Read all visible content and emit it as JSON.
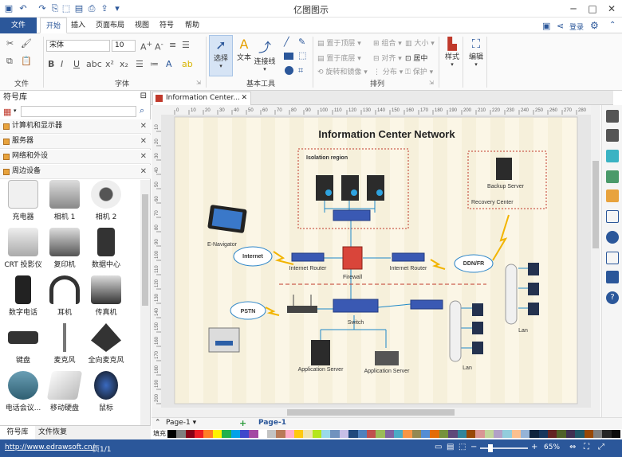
{
  "app": {
    "title": "亿图图示"
  },
  "menu": {
    "file": "文件",
    "tabs": [
      "开始",
      "插入",
      "页面布局",
      "视图",
      "符号",
      "帮助"
    ],
    "login": "登录"
  },
  "ribbon": {
    "font_name": "宋体",
    "font_size": "10",
    "groups": {
      "file": "文件",
      "font": "字体",
      "basic_tools": "基本工具",
      "arrange": "排列"
    },
    "tools": {
      "select": "选择",
      "text": "文本",
      "connector": "连接线",
      "style": "样式",
      "edit": "编辑"
    },
    "arrange": {
      "bring_front": "置于顶层",
      "group": "组合",
      "size": "大小",
      "send_back": "置于底层",
      "align": "对齐",
      "center": "居中",
      "rotate": "旋转和镜像",
      "distribute": "分布",
      "protect": "保护"
    }
  },
  "library": {
    "title": "符号库",
    "categories": [
      "计算机和显示器",
      "服务器",
      "网络和外设",
      "周边设备"
    ],
    "shapes": [
      "充电器",
      "相机 1",
      "相机 2",
      "CRT 投影仪",
      "复印机",
      "数据中心",
      "数字电话",
      "耳机",
      "传真机",
      "键盘",
      "麦克风",
      "全向麦克风",
      "电话会议...",
      "移动硬盘",
      "鼠标"
    ],
    "bottom_tabs": [
      "符号库",
      "文件恢复"
    ]
  },
  "doc": {
    "tab": "Information Center...",
    "ruler_h": [
      "0",
      "10",
      "20",
      "30",
      "40",
      "50",
      "60",
      "70",
      "80",
      "90",
      "100",
      "110",
      "120",
      "130",
      "140",
      "150",
      "160",
      "170",
      "180",
      "190",
      "200",
      "210",
      "220",
      "230",
      "240",
      "250",
      "260",
      "270",
      "280"
    ],
    "ruler_v": [
      "10",
      "20",
      "30",
      "40",
      "50",
      "60",
      "70",
      "80",
      "90",
      "100",
      "110",
      "120",
      "130",
      "140",
      "150",
      "160",
      "170",
      "180",
      "190",
      "200"
    ]
  },
  "diagram": {
    "title": "Information Center Network",
    "isolation": "Isolation region",
    "backup": "Backup Server",
    "recovery": "Recovery Center",
    "enavigator": "E-Navigator",
    "internet": "Internet",
    "router1": "Internet Router",
    "firewall": "Firewall",
    "router2": "Internet Router",
    "ddn": "DDN/FR",
    "pstn": "PSTN",
    "switch": "Switch",
    "app1": "Application Server",
    "app2": "Application Server",
    "lan1": "Lan",
    "lan2": "Lan"
  },
  "pages": {
    "current": "Page-1",
    "active": "Page-1",
    "fill": "填充"
  },
  "status": {
    "url": "http://www.edrawsoft.cn/",
    "page": "页1/1",
    "zoom": "65%"
  },
  "colors": {
    "accent": "#2b579a",
    "page_bg": "#fbf6e6"
  },
  "palette": [
    "#000000",
    "#7f7f7f",
    "#880015",
    "#ed1c24",
    "#ff7f27",
    "#fff200",
    "#22b14c",
    "#00a2e8",
    "#3f48cc",
    "#a349a4",
    "#ffffff",
    "#c3c3c3",
    "#b97a57",
    "#ffaec9",
    "#ffc90e",
    "#efe4b0",
    "#b5e61d",
    "#99d9ea",
    "#7092be",
    "#c8bfe7",
    "#1f497d",
    "#4f81bd",
    "#c0504d",
    "#9bbb59",
    "#8064a2",
    "#4bacc6",
    "#f79646",
    "#938953",
    "#548dd4",
    "#e36c09",
    "#76923c",
    "#5f497a",
    "#31859b",
    "#984806",
    "#d99694",
    "#c2d69b",
    "#b2a1c7",
    "#92cddc",
    "#fac08f",
    "#95b3d7",
    "#0f243e",
    "#17365d",
    "#632423",
    "#4f6128",
    "#3f3151",
    "#205867",
    "#974806",
    "#7f7f7f",
    "#262626",
    "#0c0c0c"
  ]
}
